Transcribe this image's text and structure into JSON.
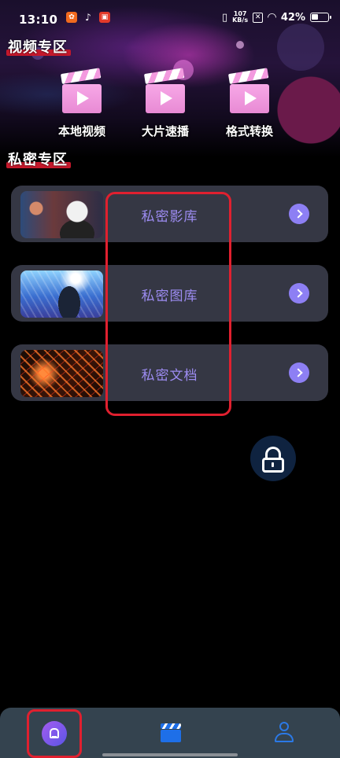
{
  "status_bar": {
    "time": "13:10",
    "app_icons": [
      "app-icon-orange",
      "tiktok-icon",
      "app-icon-red"
    ],
    "net_speed_value": "107",
    "net_speed_unit": "KB/s",
    "battery": "42%"
  },
  "video_section": {
    "title": "视频专区",
    "tools": [
      {
        "label": "本地视频",
        "icon": "clapperboard-icon"
      },
      {
        "label": "大片速播",
        "icon": "clapperboard-icon"
      },
      {
        "label": "格式转换",
        "icon": "clapperboard-icon"
      }
    ]
  },
  "private_section": {
    "title": "私密专区",
    "cards": [
      {
        "label": "私密影库"
      },
      {
        "label": "私密图库"
      },
      {
        "label": "私密文档"
      }
    ]
  },
  "bottom_nav": {
    "items": [
      {
        "icon": "home-icon",
        "active": true
      },
      {
        "icon": "clapperboard-icon",
        "active": false
      },
      {
        "icon": "user-icon",
        "active": false
      }
    ]
  },
  "colors": {
    "accent": "#8d7ff4",
    "card_bg": "#353744",
    "card_text": "#9d8cf2",
    "highlight_box": "#e0202f",
    "nav_bg": "#34434f"
  }
}
